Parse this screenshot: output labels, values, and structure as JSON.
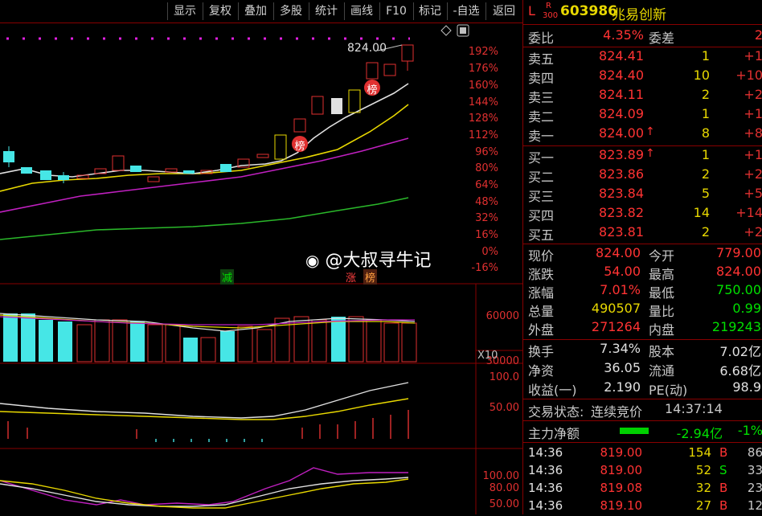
{
  "toolbar": {
    "buttons": [
      "显示",
      "复权",
      "叠加",
      "多股",
      "统计",
      "画线",
      "F10",
      "标记",
      "-自选",
      "返回"
    ]
  },
  "chart": {
    "y_labels_main": [
      "192%",
      "176%",
      "160%",
      "144%",
      "128%",
      "112%",
      "96%",
      "80%",
      "64%",
      "48%",
      "32%",
      "16%",
      "0%",
      "-16%"
    ],
    "price_tag": "824.00",
    "badge_bang": "榜",
    "label_jian": "减",
    "label_zhang": "涨",
    "label_bang": "榜",
    "vol_labels": [
      "60000",
      "30000"
    ],
    "vol_unit": "X10",
    "ind1_labels": [
      "100.0",
      "50.00"
    ],
    "ind2_labels": [
      "100.00",
      "80.00",
      "50.00"
    ],
    "watermark": "@大叔寻牛记"
  },
  "stock": {
    "flag_l": "L",
    "flag_r": "R",
    "flag_300": "300",
    "code": "603986",
    "name": "兆易创新"
  },
  "orderbook": {
    "weibi_label": "委比",
    "weibi_value": "4.35%",
    "weicha_label": "委差",
    "weicha_value": "2",
    "asks": [
      {
        "label": "卖五",
        "price": "824.41",
        "vol": "1",
        "chg": "+1"
      },
      {
        "label": "卖四",
        "price": "824.40",
        "vol": "10",
        "chg": "+10"
      },
      {
        "label": "卖三",
        "price": "824.11",
        "vol": "2",
        "chg": "+2"
      },
      {
        "label": "卖二",
        "price": "824.09",
        "vol": "1",
        "chg": "+1"
      },
      {
        "label": "卖一",
        "price": "824.00",
        "arrow": "↑",
        "vol": "8",
        "chg": "+8"
      }
    ],
    "bids": [
      {
        "label": "买一",
        "price": "823.89",
        "arrow": "↑",
        "vol": "1",
        "chg": "+1"
      },
      {
        "label": "买二",
        "price": "823.86",
        "vol": "2",
        "chg": "+2"
      },
      {
        "label": "买三",
        "price": "823.84",
        "vol": "5",
        "chg": "+5"
      },
      {
        "label": "买四",
        "price": "823.82",
        "vol": "14",
        "chg": "+14"
      },
      {
        "label": "买五",
        "price": "823.81",
        "vol": "2",
        "chg": "+2"
      }
    ]
  },
  "quote": {
    "rows": [
      {
        "l1": "现价",
        "v1": "824.00",
        "c1": "red",
        "l2": "今开",
        "v2": "779.00",
        "c2": "red"
      },
      {
        "l1": "涨跌",
        "v1": "54.00",
        "c1": "red",
        "l2": "最高",
        "v2": "824.00",
        "c2": "red"
      },
      {
        "l1": "涨幅",
        "v1": "7.01%",
        "c1": "red",
        "l2": "最低",
        "v2": "750.00",
        "c2": "green"
      },
      {
        "l1": "总量",
        "v1": "490507",
        "c1": "yellow",
        "l2": "量比",
        "v2": "0.99",
        "c2": "green"
      },
      {
        "l1": "外盘",
        "v1": "271264",
        "c1": "red",
        "l2": "内盘",
        "v2": "219243",
        "c2": "green"
      }
    ],
    "rows2": [
      {
        "l1": "换手",
        "v1": "7.34%",
        "l2": "股本",
        "v2": "7.02亿"
      },
      {
        "l1": "净资",
        "v1": "36.05",
        "l2": "流通",
        "v2": "6.68亿"
      },
      {
        "l1": "收益(一)",
        "v1": "2.190",
        "l2": "PE(动)",
        "v2": "98.9"
      }
    ],
    "status_label": "交易状态:",
    "status_value": "连续竞价",
    "status_time": "14:37:14",
    "flow_label": "主力净额",
    "flow_value": "-2.94亿",
    "flow_pct": "-1%"
  },
  "trades": [
    {
      "time": "14:36",
      "price": "819.00",
      "vol": "154",
      "side": "B",
      "n": "86"
    },
    {
      "time": "14:36",
      "price": "819.00",
      "vol": "52",
      "side": "S",
      "n": "33"
    },
    {
      "time": "14:36",
      "price": "819.08",
      "vol": "32",
      "side": "B",
      "n": "23"
    },
    {
      "time": "14:36",
      "price": "819.10",
      "vol": "27",
      "side": "B",
      "n": "12"
    }
  ]
}
